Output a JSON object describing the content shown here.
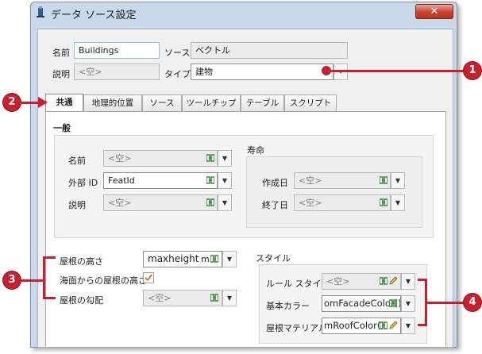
{
  "window": {
    "title": "データ ソース設定",
    "close_label": "✕"
  },
  "top": {
    "name_label": "名前",
    "name_value": "Buildings",
    "source_label": "ソース",
    "source_value": "ベクトル",
    "desc_label": "説明",
    "desc_value": "<空>",
    "type_label": "タイプ",
    "type_value": "建物"
  },
  "tabs": [
    "共通",
    "地理的位置",
    "ソース",
    "ツールチップ",
    "テーブル",
    "スクリプト"
  ],
  "general": {
    "section_label": "一般",
    "name_label": "名前",
    "name_value": "<空>",
    "external_id_label": "外部 ID",
    "external_id_value": "FeatId",
    "desc_label": "説明",
    "desc_value": "<空>"
  },
  "lifetime": {
    "label": "寿命",
    "created_label": "作成日",
    "created_value": "<空>",
    "ended_label": "終了日",
    "ended_value": "<空>"
  },
  "roof": {
    "height_label": "屋根の高さ",
    "height_value": "maxheight",
    "height_unit": "m",
    "above_sea_label": "海面からの屋根の高さ",
    "above_sea_checked": true,
    "slope_label": "屋根の勾配",
    "slope_value": "<空>"
  },
  "style": {
    "label": "スタイル",
    "rule_label": "ルール スタイル",
    "rule_value": "<空>",
    "base_color_label": "基本カラー",
    "base_color_value": "omFacadeColor()",
    "roof_material_label": "屋根マテリアル",
    "roof_material_value": "mRoofColor()"
  },
  "callouts": [
    "1",
    "2",
    "3",
    "4"
  ],
  "icons": {
    "field_link": "link-icon",
    "edit": "pencil-icon",
    "dropdown": "chevron-down-icon",
    "app": "app-icon"
  },
  "colors": {
    "callout": "#c8202e",
    "checkbox": "#e07a1f",
    "link_icon": "#3d8a3d"
  }
}
